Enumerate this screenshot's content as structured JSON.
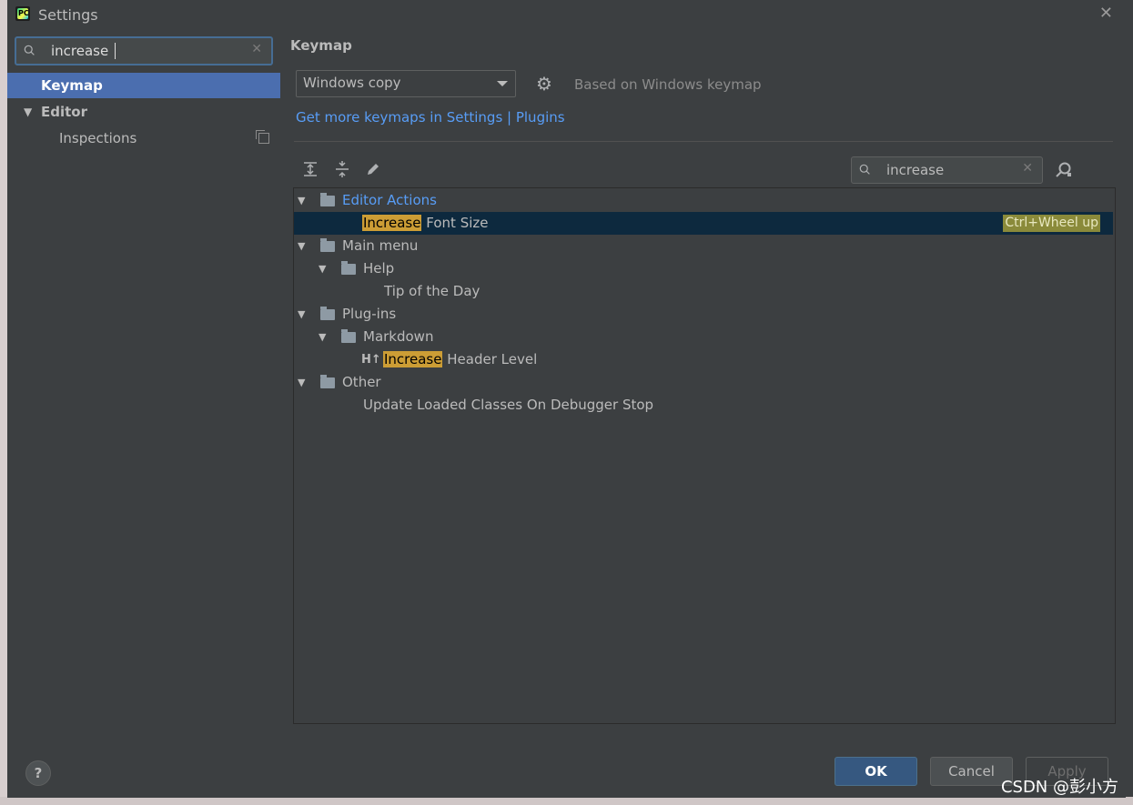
{
  "window": {
    "title": "Settings"
  },
  "sidebar": {
    "search_value": "increase",
    "items": [
      {
        "label": "Keymap"
      },
      {
        "label": "Editor"
      },
      {
        "label": "Inspections"
      }
    ]
  },
  "keymap": {
    "section_title": "Keymap",
    "selected_keymap": "Windows copy",
    "based_on": "Based on Windows keymap",
    "link_text": "Get more keymaps in Settings | Plugins",
    "filter_value": "increase",
    "tree": {
      "editor_actions": "Editor Actions",
      "increase_font_hl": "Increase",
      "increase_font_rest": "Font Size",
      "increase_font_shortcut": "Ctrl+Wheel up",
      "main_menu": "Main menu",
      "help": "Help",
      "tip": "Tip of the Day",
      "plugins": "Plug-ins",
      "markdown": "Markdown",
      "header_hl": "Increase",
      "header_rest": "Header Level",
      "header_icon_text": "H↑",
      "other": "Other",
      "update_classes": "Update Loaded Classes On Debugger Stop"
    }
  },
  "footer": {
    "help_label": "?",
    "ok": "OK",
    "cancel": "Cancel",
    "apply": "Apply"
  },
  "watermark": "CSDN @彭小方",
  "colors": {
    "selection": "#4b6eaf",
    "link": "#589df6",
    "highlight": "#cc9d35",
    "background": "#3c3f41"
  }
}
